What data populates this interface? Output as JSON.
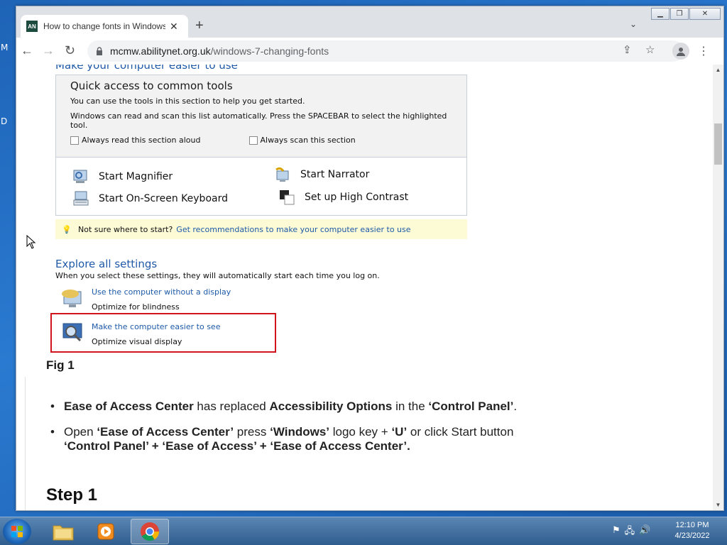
{
  "desktop": {
    "fragments": [
      "M",
      "D"
    ]
  },
  "browser": {
    "tab": {
      "favicon_text": "AN",
      "title": "How to change fonts in Windows"
    },
    "address": {
      "domain": "mcmw.abilitynet.org.uk",
      "path": "/windows-7-changing-fonts"
    }
  },
  "embedded": {
    "cut_heading": "Make your computer easier to use",
    "quick_access": {
      "title": "Quick access to common tools",
      "line1": "You can use the tools in this section to help you get started.",
      "line2": "Windows can read and scan this list automatically.  Press the SPACEBAR to select the highlighted tool.",
      "check1": "Always read this section aloud",
      "check2": "Always scan this section",
      "tools": [
        "Start Magnifier",
        "Start Narrator",
        "Start On-Screen Keyboard",
        "Set up High Contrast"
      ]
    },
    "hint": {
      "text": "Not sure where to start?",
      "link": "Get recommendations to make your computer easier to use"
    },
    "explore": {
      "title": "Explore all settings",
      "subtitle": "When you select these settings, they will automatically start each time you log on.",
      "items": [
        {
          "link": "Use the computer without a display",
          "desc": "Optimize for blindness"
        },
        {
          "link": "Make the computer easier to see",
          "desc": "Optimize visual display"
        }
      ]
    }
  },
  "article": {
    "fig_caption": "Fig 1",
    "bullet1": {
      "b1": "Ease of Access Center",
      "t1": " has replaced ",
      "b2": "Accessibility Options",
      "t2": " in the ",
      "b3": "‘Control Panel’",
      "t3": "."
    },
    "bullet2": {
      "t1": "Open ",
      "b1": "‘Ease of Access Center’",
      "t2": " press ",
      "b2": "‘Windows’",
      "t3": " logo key + ",
      "b3": "‘U’",
      "t4": " or click Start button",
      "b4": "‘Control Panel’ + ‘Ease of Access’ + ‘Ease of Access Center’."
    },
    "step_heading": "Step 1"
  },
  "taskbar": {
    "clock_time": "12:10 PM",
    "clock_date": "4/23/2022"
  }
}
